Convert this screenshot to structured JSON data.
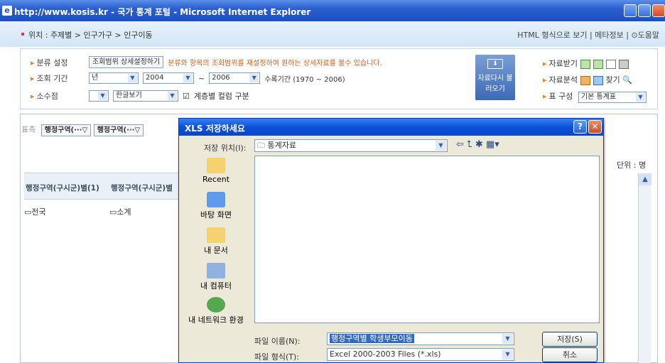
{
  "window": {
    "title": "http://www.kosis.kr - 국가 통계 포털 - Microsoft Internet Explorer"
  },
  "location": {
    "text": "위치 : 주제별 > 인구가구 > 인구이동",
    "links": "HTML 형식으로 보기 | 메타정보 | ⊙도움말"
  },
  "options": {
    "row1": {
      "label": "분류 설정",
      "button": "조회범위 상세설정하기",
      "note": "분류와 항목의 조회범위를 재설정하여 원하는 상세자료를 볼수 있습니다."
    },
    "row2": {
      "label": "조회 기간",
      "period_unit": "년",
      "from": "2004",
      "to": "2006",
      "range": "수록기간 (1970 ~ 2006)"
    },
    "row3": {
      "label": "소수점",
      "view": "한글보기",
      "checkbox": "계층별 컬럼 구분"
    },
    "reload": "자료다시 불러오기",
    "right": {
      "download": "자료받기",
      "analysis": "자료분석",
      "find": "찾기",
      "layout_label": "표 구성",
      "layout_value": "기본 통계표"
    }
  },
  "table": {
    "header_label": "표측",
    "chips": [
      "행정구역(···▽",
      "행정구역(···▽"
    ],
    "unit": "단위 : 명",
    "columns": [
      "행정구역(구시군)별(1)",
      "행정구역(구시군)별"
    ],
    "row1": [
      "▭전국",
      "▭소계"
    ]
  },
  "dialog": {
    "title": "XLS 저장하세요",
    "save_in_label": "저장 위치(I):",
    "save_in_value": "통계자료",
    "places": [
      "Recent",
      "바탕 화면",
      "내 문서",
      "내 컴퓨터",
      "내 네트워크 환경"
    ],
    "filename_label": "파일 이름(N):",
    "filename_value": "행정구역별 학생부모이동",
    "filetype_label": "파일 형식(T):",
    "filetype_value": "Excel 2000-2003 Files (*.xls)",
    "save_button": "저장(S)",
    "cancel_button": "취소"
  }
}
